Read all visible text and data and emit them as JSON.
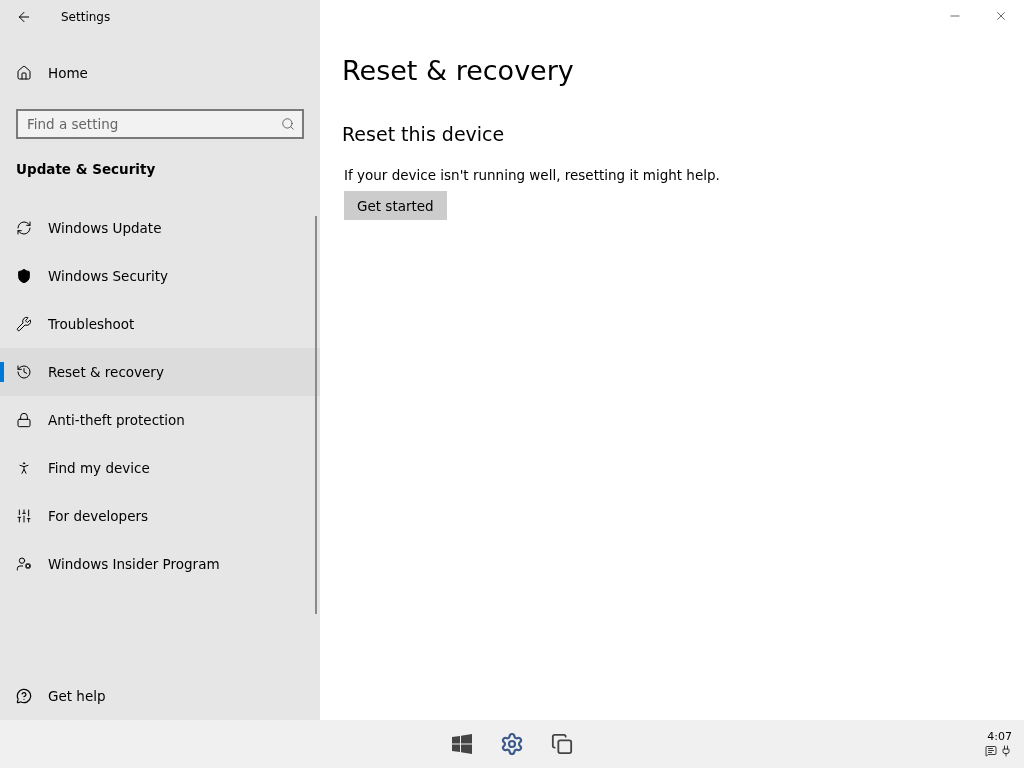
{
  "window": {
    "title": "Settings"
  },
  "sidebar": {
    "home": "Home",
    "search": {
      "placeholder": "Find a setting"
    },
    "section": "Update & Security",
    "items": [
      {
        "label": "Windows Update",
        "selected": false
      },
      {
        "label": "Windows Security",
        "selected": false
      },
      {
        "label": "Troubleshoot",
        "selected": false
      },
      {
        "label": "Reset & recovery",
        "selected": true
      },
      {
        "label": "Anti-theft protection",
        "selected": false
      },
      {
        "label": "Find my device",
        "selected": false
      },
      {
        "label": "For developers",
        "selected": false
      },
      {
        "label": "Windows Insider Program",
        "selected": false
      }
    ],
    "help": "Get help"
  },
  "main": {
    "title": "Reset & recovery",
    "section": "Reset this device",
    "description": "If your device isn't running well, resetting it might help.",
    "button": "Get started"
  },
  "taskbar": {
    "time": "4:07"
  }
}
